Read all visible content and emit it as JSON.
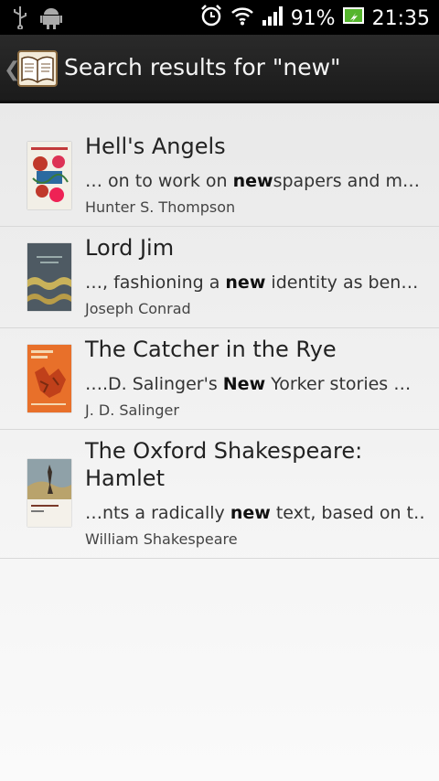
{
  "status": {
    "battery": "91%",
    "time": "21:35"
  },
  "header": {
    "title": "Search results for \"new\""
  },
  "results": [
    {
      "title": "Hell's Angels",
      "snip_pre": "… on to work on ",
      "snip_bold": "new",
      "snip_post": "spapers and m…",
      "author": "Hunter S. Thompson"
    },
    {
      "title": "Lord Jim",
      "snip_pre": " …, fashioning a ",
      "snip_bold": "new",
      "snip_post": " identity as ben…",
      "author": "Joseph Conrad"
    },
    {
      "title": "The Catcher in the Rye",
      "snip_pre": " ….D. Salinger's ",
      "snip_bold": "New",
      "snip_post": " Yorker stories …",
      "author": "J. D. Salinger"
    },
    {
      "title": "The Oxford Shakespeare: Hamlet",
      "snip_pre": "…nts a radically ",
      "snip_bold": "new",
      "snip_post": " text, based on t…",
      "author": "William Shakespeare"
    }
  ]
}
